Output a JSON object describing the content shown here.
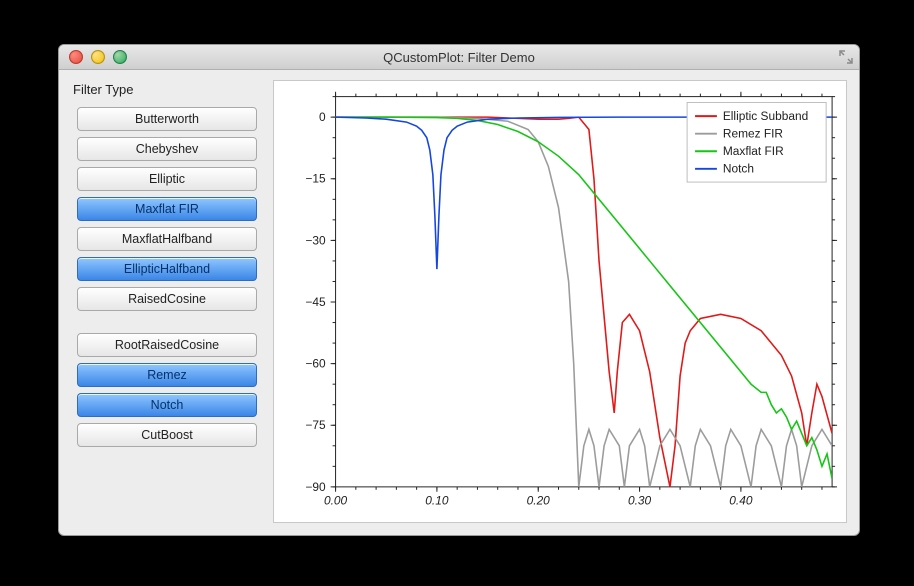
{
  "window": {
    "title": "QCustomPlot: Filter Demo"
  },
  "sidebar": {
    "group_label": "Filter Type",
    "items": [
      {
        "label": "Butterworth",
        "selected": false
      },
      {
        "label": "Chebyshev",
        "selected": false
      },
      {
        "label": "Elliptic",
        "selected": false
      },
      {
        "label": "Maxflat FIR",
        "selected": true
      },
      {
        "label": "MaxflatHalfband",
        "selected": false
      },
      {
        "label": "EllipticHalfband",
        "selected": true
      },
      {
        "label": "RaisedCosine",
        "selected": false
      },
      {
        "__gap": true
      },
      {
        "label": "RootRaisedCosine",
        "selected": false
      },
      {
        "label": "Remez",
        "selected": true
      },
      {
        "label": "Notch",
        "selected": true
      },
      {
        "label": "CutBoost",
        "selected": false
      }
    ]
  },
  "chart_data": {
    "type": "line",
    "xlabel": "",
    "ylabel": "",
    "xlim": [
      0,
      0.49
    ],
    "ylim": [
      -90,
      5
    ],
    "xticks": [
      0.0,
      0.1,
      0.2,
      0.3,
      0.4
    ],
    "yticks": [
      0,
      -15,
      -30,
      -45,
      -60,
      -75,
      -90
    ],
    "legend": {
      "position": "top-right",
      "entries": [
        "Elliptic Subband",
        "Remez FIR",
        "Maxflat FIR",
        "Notch"
      ]
    },
    "colors": {
      "Elliptic Subband": "#e11919",
      "Remez FIR": "#9c9c9c",
      "Maxflat FIR": "#16c516",
      "Notch": "#1646e1"
    },
    "series": [
      {
        "name": "Elliptic Subband",
        "x": [
          0.0,
          0.05,
          0.1,
          0.15,
          0.18,
          0.2,
          0.22,
          0.23,
          0.24,
          0.25,
          0.255,
          0.26,
          0.27,
          0.275,
          0.278,
          0.283,
          0.29,
          0.3,
          0.31,
          0.32,
          0.33,
          0.335,
          0.34,
          0.345,
          0.35,
          0.36,
          0.38,
          0.4,
          0.42,
          0.44,
          0.45,
          0.46,
          0.465,
          0.47,
          0.475,
          0.48,
          0.49
        ],
        "y": [
          0,
          0,
          0,
          0,
          -0.3,
          -0.5,
          -0.5,
          -0.3,
          0,
          -3,
          -15,
          -35,
          -62,
          -72,
          -62,
          -50,
          -48,
          -52,
          -62,
          -78,
          -90,
          -80,
          -63,
          -55,
          -52,
          -49,
          -48,
          -49,
          -52,
          -58,
          -63,
          -72,
          -80,
          -72,
          -65,
          -68,
          -77
        ]
      },
      {
        "name": "Remez FIR",
        "x": [
          0.0,
          0.05,
          0.1,
          0.14,
          0.17,
          0.19,
          0.2,
          0.21,
          0.22,
          0.23,
          0.235,
          0.24,
          0.245,
          0.25,
          0.255,
          0.26,
          0.265,
          0.27,
          0.28,
          0.285,
          0.29,
          0.3,
          0.305,
          0.31,
          0.32,
          0.33,
          0.34,
          0.35,
          0.355,
          0.36,
          0.37,
          0.38,
          0.385,
          0.39,
          0.4,
          0.41,
          0.415,
          0.42,
          0.43,
          0.44,
          0.445,
          0.45,
          0.455,
          0.46,
          0.47,
          0.48,
          0.49
        ],
        "y": [
          0,
          0,
          0,
          -0.3,
          -1,
          -3,
          -6,
          -12,
          -22,
          -40,
          -60,
          -90,
          -80,
          -76,
          -80,
          -90,
          -80,
          -76,
          -80,
          -90,
          -80,
          -76,
          -80,
          -90,
          -80,
          -76,
          -80,
          -90,
          -80,
          -76,
          -80,
          -90,
          -80,
          -76,
          -80,
          -90,
          -80,
          -76,
          -80,
          -90,
          -80,
          -76,
          -80,
          -90,
          -80,
          -76,
          -80
        ]
      },
      {
        "name": "Maxflat FIR",
        "x": [
          0.0,
          0.05,
          0.1,
          0.12,
          0.14,
          0.16,
          0.18,
          0.2,
          0.22,
          0.24,
          0.25,
          0.27,
          0.29,
          0.31,
          0.33,
          0.35,
          0.37,
          0.39,
          0.41,
          0.42,
          0.425,
          0.43,
          0.435,
          0.44,
          0.445,
          0.45,
          0.455,
          0.46,
          0.465,
          0.47,
          0.475,
          0.48,
          0.485,
          0.49
        ],
        "y": [
          0,
          0,
          -0.1,
          -0.3,
          -0.8,
          -1.8,
          -3.5,
          -6,
          -9.5,
          -14,
          -17,
          -23,
          -29,
          -35,
          -41,
          -47,
          -53,
          -59,
          -65,
          -67,
          -67,
          -70,
          -72,
          -71,
          -73,
          -76,
          -74,
          -77,
          -80,
          -78,
          -81,
          -85,
          -82,
          -88
        ]
      },
      {
        "name": "Notch",
        "x": [
          0.0,
          0.03,
          0.05,
          0.07,
          0.08,
          0.085,
          0.09,
          0.093,
          0.096,
          0.098,
          0.1,
          0.102,
          0.104,
          0.107,
          0.11,
          0.115,
          0.12,
          0.13,
          0.15,
          0.18,
          0.22,
          0.28,
          0.34,
          0.4,
          0.49
        ],
        "y": [
          0,
          -0.2,
          -0.5,
          -1.2,
          -2.2,
          -3.2,
          -5,
          -8,
          -14,
          -24,
          -37,
          -24,
          -14,
          -8,
          -5,
          -3.2,
          -2.2,
          -1.2,
          -0.5,
          -0.2,
          -0.05,
          0,
          0,
          0,
          0
        ]
      }
    ]
  }
}
